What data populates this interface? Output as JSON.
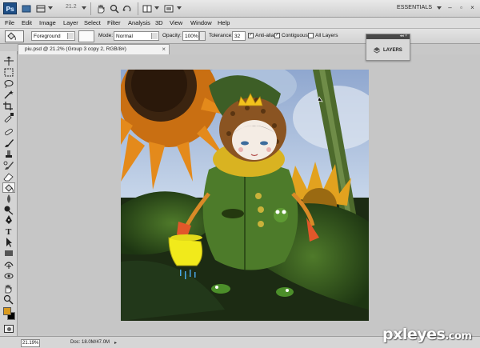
{
  "app": {
    "logo_text": "Ps",
    "zoom_value": "21.2",
    "workspace_label": "ESSENTIALS",
    "window_controls": [
      "–",
      "▫",
      "×"
    ]
  },
  "menu": {
    "items": [
      "File",
      "Edit",
      "Image",
      "Layer",
      "Select",
      "Filter",
      "Analysis",
      "3D",
      "View",
      "Window",
      "Help"
    ]
  },
  "options": {
    "fill_source": "Foreground",
    "mode_label": "Mode:",
    "mode_value": "Normal",
    "opacity_label": "Opacity:",
    "opacity_value": "100%",
    "tolerance_label": "Tolerance:",
    "tolerance_value": "32",
    "anti_alias_label": "Anti-alias",
    "contiguous_label": "Contiguous",
    "all_layers_label": "All Layers"
  },
  "document": {
    "tab_title": "piu.psd @ 21.2% (Group 3 copy 2, RGB/8#)"
  },
  "layers_panel": {
    "title": "LAYERS"
  },
  "status": {
    "zoom": "21.19%",
    "doc_info": "Doc: 18.0M/47.0M"
  },
  "watermark": {
    "text": "pxleyes",
    "suffix": ".com"
  },
  "icons": {
    "active_tool": "paint-bucket-icon",
    "tools": [
      "move-icon",
      "marquee-icon",
      "lasso-icon",
      "magic-wand-icon",
      "crop-icon",
      "eyedropper-icon",
      "spot-healing-icon",
      "brush-icon",
      "clone-stamp-icon",
      "history-brush-icon",
      "eraser-icon",
      "paint-bucket-icon",
      "blur-icon",
      "dodge-icon",
      "pen-icon",
      "type-icon",
      "path-selection-icon",
      "shape-icon",
      "3d-rotate-icon",
      "3d-orbit-icon",
      "hand-icon",
      "zoom-icon"
    ]
  },
  "colors": {
    "foreground_swatch": "#d99a1e",
    "background_swatch": "#000000"
  }
}
